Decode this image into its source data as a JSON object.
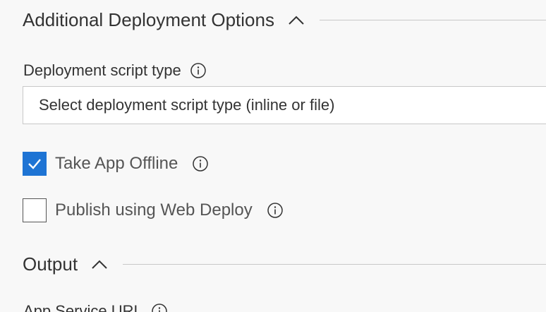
{
  "sections": {
    "additional": {
      "title": "Additional Deployment Options"
    },
    "output": {
      "title": "Output"
    }
  },
  "fields": {
    "script_type": {
      "label": "Deployment script type",
      "placeholder": "Select deployment script type (inline or file)"
    },
    "app_service_url": {
      "label": "App Service URL"
    }
  },
  "checkboxes": {
    "take_app_offline": {
      "label": "Take App Offline",
      "checked": true
    },
    "web_deploy": {
      "label": "Publish using Web Deploy",
      "checked": false
    }
  },
  "colors": {
    "accent": "#1e74d4",
    "background": "#f8f8f8"
  },
  "icons": {
    "collapse": "chevron-up-icon",
    "info": "info-icon",
    "check": "checkmark-icon"
  }
}
